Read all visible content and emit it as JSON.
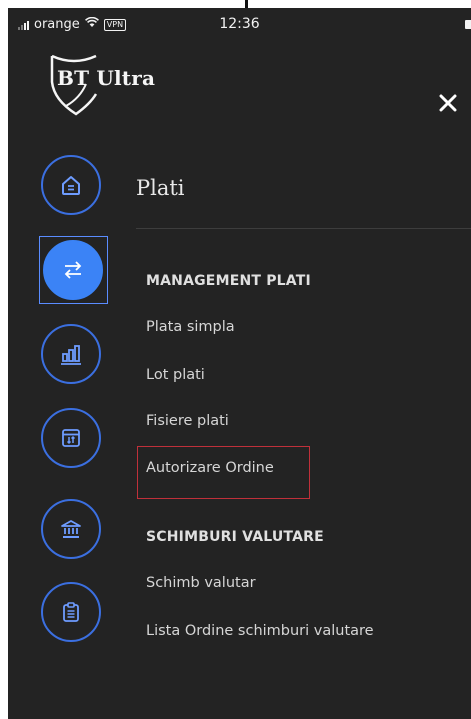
{
  "status_bar": {
    "carrier": "orange",
    "vpn_label": "VPN",
    "time": "12:36"
  },
  "app": {
    "logo_text": "BT Ultra"
  },
  "rail": {
    "items": [
      {
        "icon": "home-icon"
      },
      {
        "icon": "transfer-icon",
        "active": true
      },
      {
        "icon": "chart-icon"
      },
      {
        "icon": "calendar-exchange-icon"
      },
      {
        "icon": "bank-icon"
      },
      {
        "icon": "clipboard-icon"
      }
    ]
  },
  "menu": {
    "title": "Plati",
    "sections": [
      {
        "header": "MANAGEMENT PLATI",
        "items": [
          "Plata simpla",
          "Lot plati",
          "Fisiere plati",
          "Autorizare Ordine"
        ]
      },
      {
        "header": "SCHIMBURI VALUTARE",
        "items": [
          "Schimb valutar",
          "Lista Ordine schimburi valutare"
        ]
      }
    ]
  },
  "colors": {
    "background": "#232323",
    "accent": "#3b83f6",
    "highlight_border": "#c0303a"
  }
}
